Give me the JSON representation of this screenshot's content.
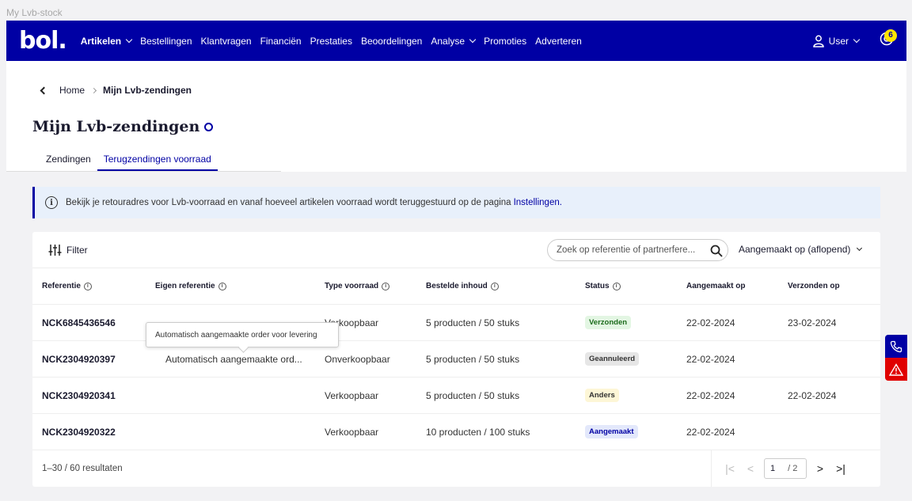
{
  "window": {
    "title": "My Lvb-stock"
  },
  "brand": {
    "logo_text": "bol.",
    "primary_color": "#0000a4",
    "badge_color": "#ffe500"
  },
  "nav": {
    "items": [
      {
        "label": "Artikelen",
        "dropdown": true,
        "active": true
      },
      {
        "label": "Bestellingen"
      },
      {
        "label": "Klantvragen"
      },
      {
        "label": "Financiën"
      },
      {
        "label": "Prestaties"
      },
      {
        "label": "Beoordelingen"
      },
      {
        "label": "Analyse",
        "dropdown": true
      },
      {
        "label": "Promoties"
      },
      {
        "label": "Adverteren"
      }
    ],
    "user_label": "User",
    "help_badge_count": "6"
  },
  "breadcrumb": {
    "home": "Home",
    "current": "Mijn Lvb-zendingen"
  },
  "page": {
    "title": "Mijn Lvb-zendingen"
  },
  "tabs": [
    {
      "label": "Zendingen",
      "active": false
    },
    {
      "label": "Terugzendingen voorraad",
      "active": true
    }
  ],
  "info": {
    "text": "Bekijk je retouradres voor Lvb-voorraad en vanaf hoeveel artikelen voorraad wordt teruggestuurd op de pagina",
    "link": "Instellingen."
  },
  "toolbar": {
    "filter_label": "Filter",
    "search_placeholder": "Zoek op referentie of partnerfere...",
    "sort_label": "Aangemaakt op (aflopend)"
  },
  "table": {
    "headers": {
      "referentie": "Referentie",
      "eigen_referentie": "Eigen referentie",
      "type_voorraad": "Type voorraad",
      "bestelde_inhoud": "Bestelde inhoud",
      "status": "Status",
      "aangemaakt_op": "Aangemaakt op",
      "verzonden_op": "Verzonden op"
    },
    "rows": [
      {
        "ref": "NCK6845436546",
        "eigen": "",
        "type": "Verkoopbaar",
        "inhoud": "5 producten / 50 stuks",
        "status": "Verzonden",
        "aangemaakt": "22-02-2024",
        "verzonden": "23-02-2024"
      },
      {
        "ref": "NCK2304920397",
        "eigen": "Automatisch aangemaakte ord...",
        "type": "Onverkoopbaar",
        "inhoud": "5 producten / 50 stuks",
        "status": "Geannuleerd",
        "aangemaakt": "22-02-2024",
        "verzonden": ""
      },
      {
        "ref": "NCK2304920341",
        "eigen": "",
        "type": "Verkoopbaar",
        "inhoud": "5 producten / 50 stuks",
        "status": "Anders",
        "aangemaakt": "22-02-2024",
        "verzonden": "22-02-2024"
      },
      {
        "ref": "NCK2304920322",
        "eigen": "",
        "type": "Verkoopbaar",
        "inhoud": "10 producten / 100 stuks",
        "status": "Aangemaakt",
        "aangemaakt": "22-02-2024",
        "verzonden": ""
      }
    ],
    "status_colors": {
      "Verzonden": {
        "bg": "#e3f6e3",
        "fg": "#1c6b1c"
      },
      "Geannuleerd": {
        "bg": "#e6e6e6",
        "fg": "#333333"
      },
      "Anders": {
        "bg": "#fdf6d6",
        "fg": "#333333"
      },
      "Aangemaakt": {
        "bg": "#e3e8fb",
        "fg": "#0000a4"
      }
    }
  },
  "tooltip": {
    "text": "Automatisch aangemaakte order voor levering"
  },
  "footer": {
    "results": "1–30 / 60 resultaten",
    "page": "1",
    "total": "/ 2"
  },
  "side_buttons": [
    {
      "icon": "phone-icon",
      "color": "#0000a4"
    },
    {
      "icon": "warning-icon",
      "color": "#e00000"
    }
  ]
}
